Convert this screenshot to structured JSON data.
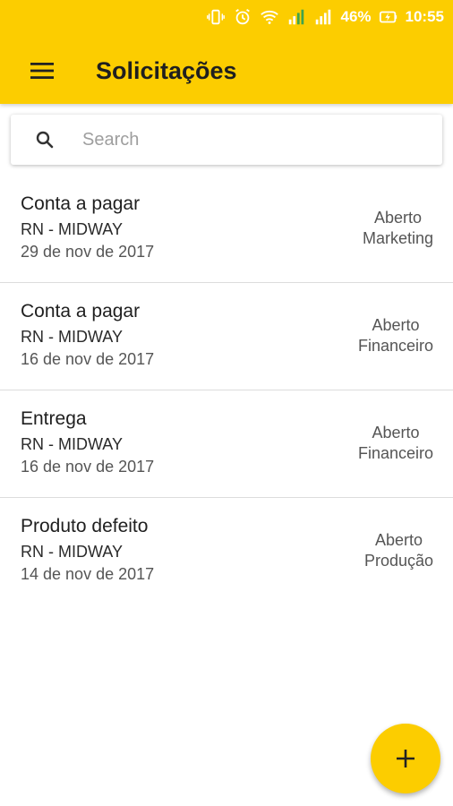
{
  "status_bar": {
    "battery": "46%",
    "time": "10:55",
    "icons": [
      "vibrate-icon",
      "alarm-icon",
      "wifi-icon",
      "signal-1-icon",
      "signal-2-icon",
      "battery-charging-icon"
    ]
  },
  "app_bar": {
    "title": "Solicitações",
    "color": "#fccd00",
    "menu_icon": "hamburger-menu-icon"
  },
  "search": {
    "placeholder": "Search",
    "value": ""
  },
  "requests": [
    {
      "title": "Conta a pagar",
      "company": "RN - MIDWAY",
      "date": "29 de nov de 2017",
      "status": "Aberto",
      "department": "Marketing"
    },
    {
      "title": "Conta a pagar",
      "company": "RN - MIDWAY",
      "date": "16 de nov de 2017",
      "status": "Aberto",
      "department": "Financeiro"
    },
    {
      "title": "Entrega",
      "company": "RN - MIDWAY",
      "date": "16 de nov de 2017",
      "status": "Aberto",
      "department": "Financeiro"
    },
    {
      "title": "Produto defeito",
      "company": "RN - MIDWAY",
      "date": "14 de nov de 2017",
      "status": "Aberto",
      "department": "Produção"
    }
  ],
  "fab": {
    "icon": "plus-icon"
  }
}
